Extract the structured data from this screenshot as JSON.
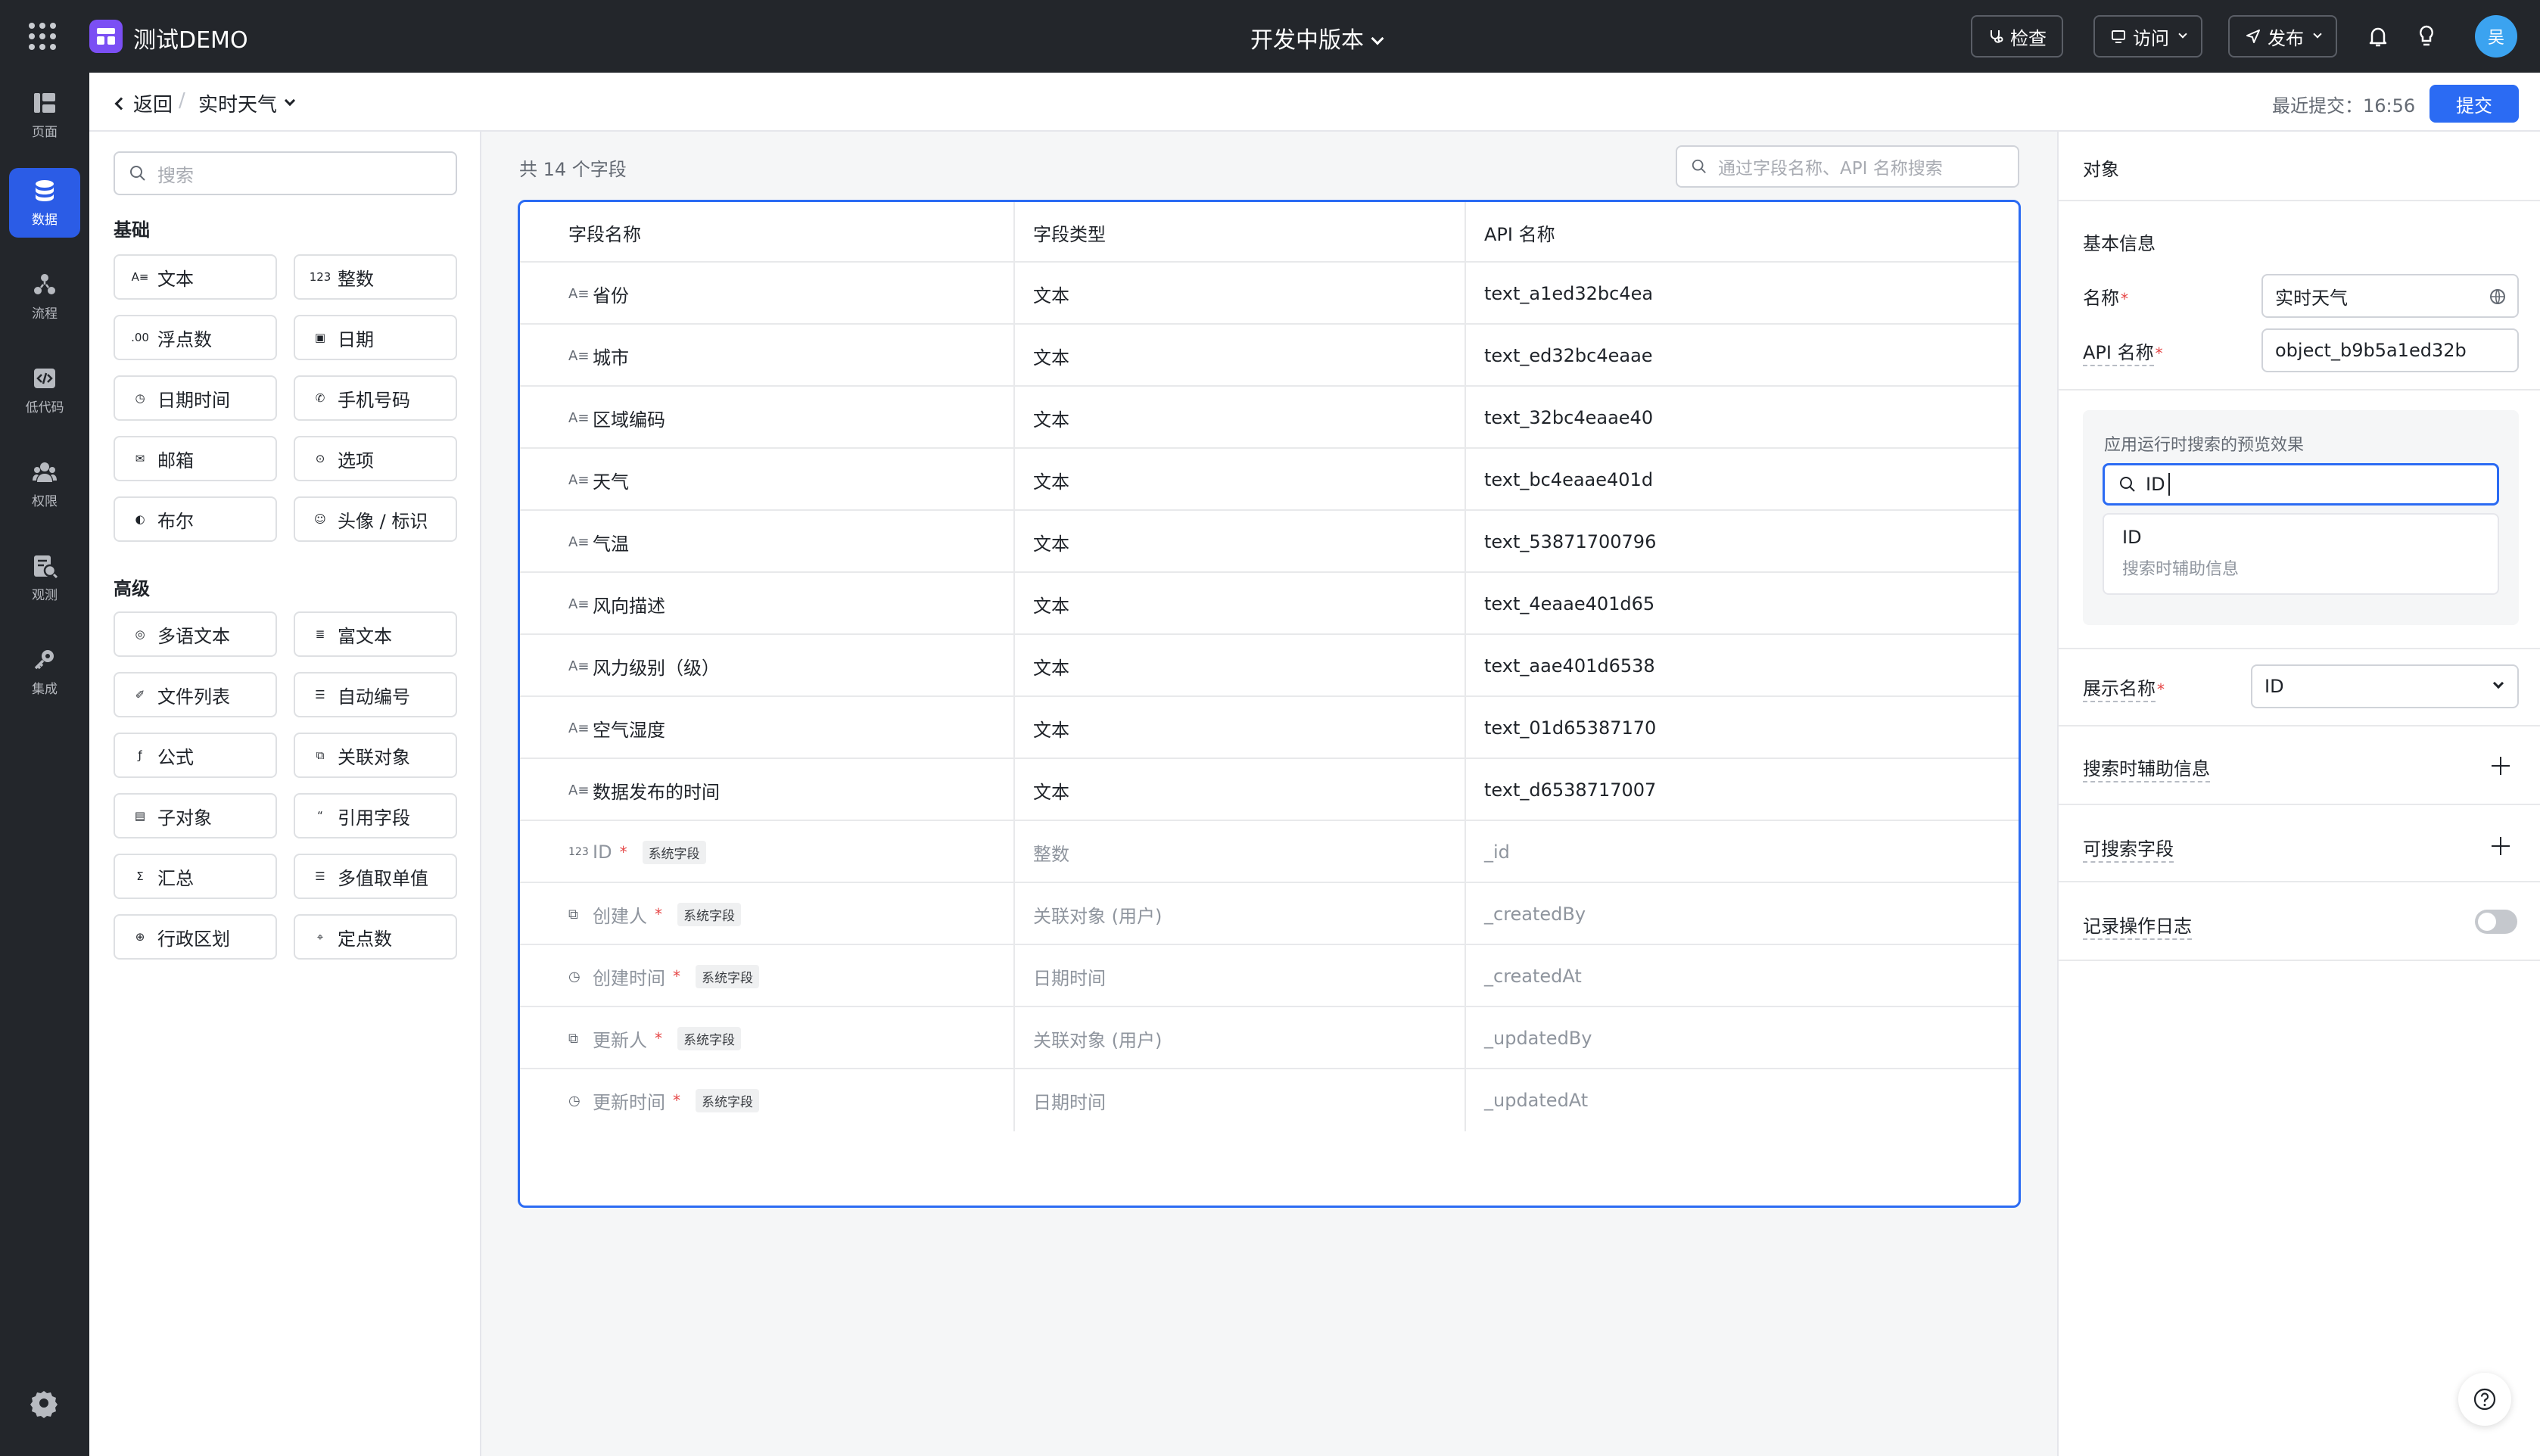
{
  "app": {
    "name": "测试DEMO",
    "version": "开发中版本",
    "buttons": {
      "check": "检查",
      "access": "访问",
      "publish": "发布"
    },
    "avatar": "吴"
  },
  "rail": {
    "items": [
      {
        "label": "页面",
        "icon": "pages-icon"
      },
      {
        "label": "数据",
        "icon": "database-icon",
        "active": true
      },
      {
        "label": "流程",
        "icon": "flow-icon"
      },
      {
        "label": "低代码",
        "icon": "code-icon"
      },
      {
        "label": "权限",
        "icon": "users-icon"
      },
      {
        "label": "观测",
        "icon": "monitor-icon"
      },
      {
        "label": "集成",
        "icon": "key-icon"
      }
    ]
  },
  "header": {
    "back": "返回",
    "separator": "/",
    "object_name": "实时天气",
    "last_submit": "最近提交：16:56",
    "submit": "提交"
  },
  "left_panel": {
    "search_placeholder": "搜索",
    "basic_title": "基础",
    "basic": [
      {
        "label": "文本",
        "icon": "text-icon"
      },
      {
        "label": "整数",
        "icon": "integer-icon"
      },
      {
        "label": "浮点数",
        "icon": "float-icon"
      },
      {
        "label": "日期",
        "icon": "calendar-icon"
      },
      {
        "label": "日期时间",
        "icon": "clock-icon"
      },
      {
        "label": "手机号码",
        "icon": "phone-icon"
      },
      {
        "label": "邮箱",
        "icon": "mail-icon"
      },
      {
        "label": "选项",
        "icon": "option-icon"
      },
      {
        "label": "布尔",
        "icon": "toggle-icon"
      },
      {
        "label": "头像 / 标识",
        "icon": "avatar-icon"
      }
    ],
    "advanced_title": "高级",
    "advanced": [
      {
        "label": "多语文本",
        "icon": "globe-icon"
      },
      {
        "label": "富文本",
        "icon": "richtext-icon"
      },
      {
        "label": "文件列表",
        "icon": "attachment-icon"
      },
      {
        "label": "自动编号",
        "icon": "list-number-icon"
      },
      {
        "label": "公式",
        "icon": "formula-icon"
      },
      {
        "label": "关联对象",
        "icon": "link-object-icon"
      },
      {
        "label": "子对象",
        "icon": "sub-object-icon"
      },
      {
        "label": "引用字段",
        "icon": "quote-icon"
      },
      {
        "label": "汇总",
        "icon": "sigma-icon"
      },
      {
        "label": "多值取单值",
        "icon": "multi-value-icon"
      },
      {
        "label": "行政区划",
        "icon": "region-icon"
      },
      {
        "label": "定点数",
        "icon": "decimal-icon"
      }
    ]
  },
  "fields": {
    "count": "共 14 个字段",
    "search_placeholder": "通过字段名称、API 名称搜索",
    "headers": [
      "字段名称",
      "字段类型",
      "API 名称"
    ],
    "system_tag": "系统字段",
    "rows": [
      {
        "name": "省份",
        "type": "文本",
        "api": "text_a1ed32bc4ea",
        "icon": "text-icon",
        "system": false
      },
      {
        "name": "城市",
        "type": "文本",
        "api": "text_ed32bc4eaae",
        "icon": "text-icon",
        "system": false
      },
      {
        "name": "区域编码",
        "type": "文本",
        "api": "text_32bc4eaae40",
        "icon": "text-icon",
        "system": false
      },
      {
        "name": "天气",
        "type": "文本",
        "api": "text_bc4eaae401d",
        "icon": "text-icon",
        "system": false
      },
      {
        "name": "气温",
        "type": "文本",
        "api": "text_53871700796",
        "icon": "text-icon",
        "system": false
      },
      {
        "name": "风向描述",
        "type": "文本",
        "api": "text_4eaae401d65",
        "icon": "text-icon",
        "system": false
      },
      {
        "name": "风力级别（级）",
        "type": "文本",
        "api": "text_aae401d6538",
        "icon": "text-icon",
        "system": false
      },
      {
        "name": "空气湿度",
        "type": "文本",
        "api": "text_01d65387170",
        "icon": "text-icon",
        "system": false
      },
      {
        "name": "数据发布的时间",
        "type": "文本",
        "api": "text_d6538717007",
        "icon": "text-icon",
        "system": false
      },
      {
        "name": "ID",
        "type": "整数",
        "api": "_id",
        "icon": "integer-icon",
        "system": true
      },
      {
        "name": "创建人",
        "type": "关联对象 (用户)",
        "api": "_createdBy",
        "icon": "link-object-icon",
        "system": true
      },
      {
        "name": "创建时间",
        "type": "日期时间",
        "api": "_createdAt",
        "icon": "clock-icon",
        "system": true
      },
      {
        "name": "更新人",
        "type": "关联对象 (用户)",
        "api": "_updatedBy",
        "icon": "link-object-icon",
        "system": true
      },
      {
        "name": "更新时间",
        "type": "日期时间",
        "api": "_updatedAt",
        "icon": "clock-icon",
        "system": true
      }
    ]
  },
  "right_panel": {
    "title": "对象",
    "basic_info": "基本信息",
    "name_label": "名称",
    "name_value": "实时天气",
    "api_label": "API 名称",
    "api_value": "object_b9b5a1ed32b",
    "preview_title": "应用运行时搜索的预览效果",
    "preview_query": "ID",
    "preview_option_title": "ID",
    "preview_option_sub": "搜索时辅助信息",
    "display_name_label": "展示名称",
    "display_name_value": "ID",
    "search_aux_label": "搜索时辅助信息",
    "searchable_label": "可搜索字段",
    "log_label": "记录操作日志",
    "log_enabled": false
  },
  "colors": {
    "accent": "#2b6bf3",
    "topbar": "#23262b",
    "brand": "#7b4ff4",
    "required": "#e54545"
  }
}
